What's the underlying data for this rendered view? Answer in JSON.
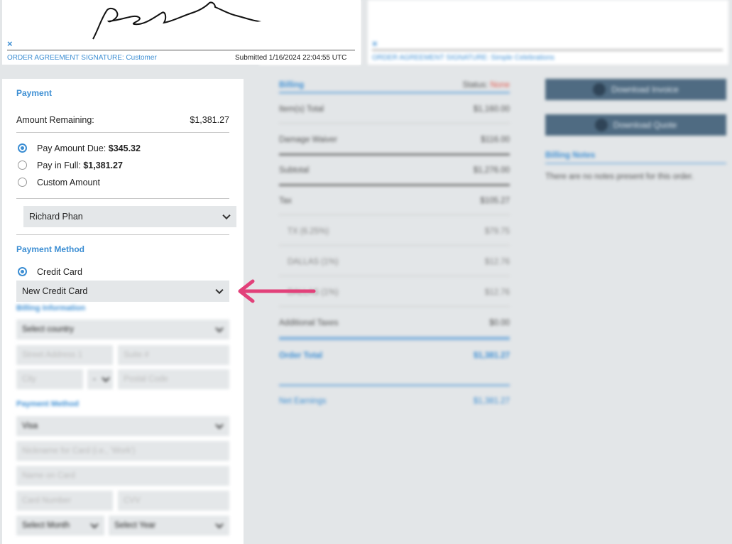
{
  "signatures": {
    "customer": {
      "close_glyph": "×",
      "label": "ORDER AGREEMENT SIGNATURE: Customer",
      "submitted": "Submitted 1/16/2024 22:04:55 UTC"
    },
    "company": {
      "close_glyph": "×",
      "label": "ORDER AGREEMENT SIGNATURE: Simple Celebrations"
    }
  },
  "payment": {
    "title": "Payment",
    "amount_remaining_label": "Amount Remaining:",
    "amount_remaining_value": "$1,381.27",
    "options": [
      {
        "label": "Pay Amount Due: ",
        "value": "$345.32",
        "selected": true
      },
      {
        "label": "Pay in Full: ",
        "value": "$1,381.27",
        "selected": false
      },
      {
        "label": "Custom Amount",
        "value": "",
        "selected": false
      }
    ],
    "payer_select": "Richard Phan",
    "method_title": "Payment Method",
    "method_option": "Credit Card",
    "card_select": "New Credit Card",
    "billing_info_title": "Billing Information",
    "country_select": "Select country",
    "street_placeholder": "Street Address 1",
    "suite_placeholder": "Suite #",
    "city_placeholder": "City",
    "state_select": "-",
    "postal_placeholder": "Postal Code",
    "method_title_2": "Payment Method",
    "card_type_select": "Visa",
    "nickname_placeholder": "Nickname for Card (i.e., 'Work')",
    "name_placeholder": "Name on Card",
    "number_placeholder": "Card Number",
    "cvv_placeholder": "CVV",
    "month_select": "Select Month",
    "year_select": "Select Year"
  },
  "billing": {
    "title": "Billing",
    "status_label": "Status:",
    "status_value": "None",
    "status_color": "#e05a4f",
    "rows": [
      {
        "label": "Item(s) Total",
        "value": "$1,160.00"
      },
      {
        "label": "Damage Waiver",
        "value": "$116.00"
      },
      {
        "label": "Subtotal",
        "value": "$1,276.00"
      },
      {
        "label": "Tax",
        "value": "$105.27"
      },
      {
        "label": "TX (6.25%)",
        "value": "$79.75"
      },
      {
        "label": "DALLAS (1%)",
        "value": "$12.76"
      },
      {
        "label": "DALLAS (1%)",
        "value": "$12.76"
      },
      {
        "label": "Additional Taxes",
        "value": "$0.00"
      }
    ],
    "order_total_label": "Order Total",
    "order_total_value": "$1,381.27",
    "net_earnings_label": "Net Earnings",
    "net_earnings_value": "$1,381.27"
  },
  "actions": {
    "download_invoice": "Download Invoice",
    "download_quote": "Download Quote",
    "notes_title": "Billing Notes",
    "notes_text": "There are no notes present for this order."
  },
  "colors": {
    "accent": "#3c8ed3",
    "annotation_arrow": "#e2417a"
  }
}
